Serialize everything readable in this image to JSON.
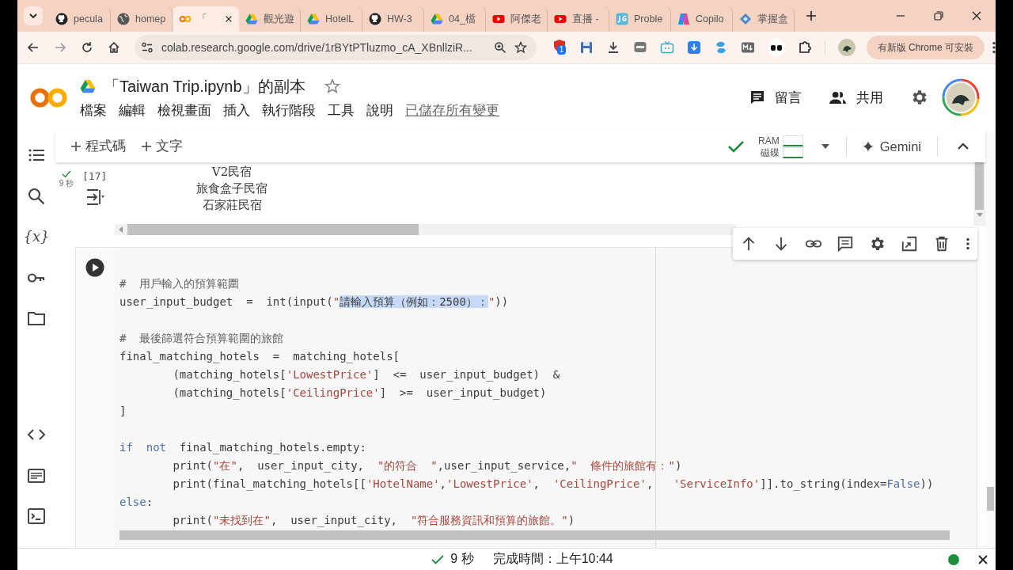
{
  "browser": {
    "tabs": [
      {
        "title": "pecula",
        "kind": "github",
        "selected": false
      },
      {
        "title": "homep",
        "kind": "globe",
        "selected": false
      },
      {
        "title": "「",
        "kind": "colab",
        "selected": true
      },
      {
        "title": "觀光遊",
        "kind": "drive",
        "selected": false
      },
      {
        "title": "HotelL",
        "kind": "drive",
        "selected": false
      },
      {
        "title": "HW-3",
        "kind": "github",
        "selected": false
      },
      {
        "title": "04_檔",
        "kind": "drive",
        "selected": false
      },
      {
        "title": "阿傑老",
        "kind": "youtube",
        "selected": false
      },
      {
        "title": "直播 -",
        "kind": "youtube",
        "selected": false
      },
      {
        "title": "Proble",
        "kind": "jg",
        "selected": false
      },
      {
        "title": "Copilo",
        "kind": "copilot",
        "selected": false
      },
      {
        "title": "掌握盒",
        "kind": "diamond",
        "selected": false
      }
    ],
    "url": "colab.research.google.com/drive/1rBYtPTluzmo_cA_XBnllziR...",
    "extension_badge": "1",
    "update_button": "有新版 Chrome 可安裝"
  },
  "notebook": {
    "title": "「Taiwan Trip.ipynb」的副本",
    "menus": [
      "檔案",
      "編輯",
      "檢視畫面",
      "插入",
      "執行階段",
      "工具",
      "說明"
    ],
    "save_status": "已儲存所有變更",
    "comment_button": "留言",
    "share_button": "共用",
    "toolbar": {
      "add_code": "程式碼",
      "add_text": "文字",
      "ram_label": "RAM",
      "disk_label": "磁碟",
      "gemini": "Gemini"
    },
    "rail": [
      {
        "kind": "toc"
      },
      {
        "kind": "search"
      },
      {
        "kind": "variables",
        "label": "{x}"
      },
      {
        "kind": "key"
      },
      {
        "kind": "folder"
      },
      {
        "kind": "gap"
      },
      {
        "kind": "code"
      },
      {
        "kind": "palette"
      },
      {
        "kind": "terminal"
      }
    ],
    "output_cell": {
      "count": "[17]",
      "duration": "9 秒",
      "output_lines": [
        "V2民宿",
        "旅食盒子民宿",
        "石家莊民宿"
      ]
    },
    "code_cell": {
      "lines": [
        {
          "kind": "blank"
        },
        {
          "kind": "code",
          "segments": [
            {
              "kind": "comment",
              "text": "#  用戶輸入的預算範圍"
            }
          ]
        },
        {
          "kind": "code",
          "segments": [
            {
              "kind": "plain",
              "text": "user_input_budget  =  int(input("
            },
            {
              "kind": "string",
              "text": "\""
            },
            {
              "kind": "selection",
              "text": "請輸入預算（例如：2500）："
            },
            {
              "kind": "string",
              "text": "\""
            },
            {
              "kind": "plain",
              "text": "))"
            }
          ]
        },
        {
          "kind": "blank"
        },
        {
          "kind": "code",
          "segments": [
            {
              "kind": "comment",
              "text": "#  最後篩選符合預算範圍的旅館"
            }
          ]
        },
        {
          "kind": "code",
          "segments": [
            {
              "kind": "plain",
              "text": "final_matching_hotels  =  matching_hotels["
            }
          ]
        },
        {
          "kind": "code",
          "segments": [
            {
              "kind": "plain",
              "text": "        (matching_hotels["
            },
            {
              "kind": "string",
              "text": "'LowestPrice'"
            },
            {
              "kind": "plain",
              "text": "]  <=  user_input_budget)  &"
            }
          ]
        },
        {
          "kind": "code",
          "segments": [
            {
              "kind": "plain",
              "text": "        (matching_hotels["
            },
            {
              "kind": "string",
              "text": "'CeilingPrice'"
            },
            {
              "kind": "plain",
              "text": "]  >=  user_input_budget)"
            }
          ]
        },
        {
          "kind": "code",
          "segments": [
            {
              "kind": "plain",
              "text": "]"
            }
          ]
        },
        {
          "kind": "blank"
        },
        {
          "kind": "code",
          "segments": [
            {
              "kind": "keyword",
              "text": "if  not"
            },
            {
              "kind": "plain",
              "text": "  final_matching_hotels.empty:"
            }
          ]
        },
        {
          "kind": "code",
          "segments": [
            {
              "kind": "plain",
              "text": "        print("
            },
            {
              "kind": "string",
              "text": "\"在\""
            },
            {
              "kind": "plain",
              "text": ",  user_input_city,  "
            },
            {
              "kind": "string",
              "text": "\"的符合  \""
            },
            {
              "kind": "plain",
              "text": ",user_input_service,"
            },
            {
              "kind": "string",
              "text": "\"  條件的旅館有：\""
            },
            {
              "kind": "plain",
              "text": ")"
            }
          ]
        },
        {
          "kind": "code",
          "segments": [
            {
              "kind": "plain",
              "text": "        print(final_matching_hotels[["
            },
            {
              "kind": "string",
              "text": "'HotelName'"
            },
            {
              "kind": "plain",
              "text": ","
            },
            {
              "kind": "string",
              "text": "'LowestPrice'"
            },
            {
              "kind": "plain",
              "text": ",  "
            },
            {
              "kind": "string",
              "text": "'CeilingPrice'"
            },
            {
              "kind": "plain",
              "text": ",   "
            },
            {
              "kind": "string",
              "text": "'ServiceInfo'"
            },
            {
              "kind": "plain",
              "text": "]].to_string(index="
            },
            {
              "kind": "keyword",
              "text": "False"
            },
            {
              "kind": "plain",
              "text": "))"
            }
          ]
        },
        {
          "kind": "code",
          "segments": [
            {
              "kind": "keyword",
              "text": "else"
            },
            {
              "kind": "plain",
              "text": ":"
            }
          ]
        },
        {
          "kind": "code",
          "segments": [
            {
              "kind": "plain",
              "text": "        print("
            },
            {
              "kind": "string",
              "text": "\"未找到在\""
            },
            {
              "kind": "plain",
              "text": ",  user_input_city,  "
            },
            {
              "kind": "string",
              "text": "\"符合服務資訊和預算的旅館。\""
            },
            {
              "kind": "plain",
              "text": ")"
            }
          ]
        }
      ]
    }
  },
  "status_bar": {
    "duration": "9 秒",
    "completed": "完成時間：上午10:44"
  }
}
